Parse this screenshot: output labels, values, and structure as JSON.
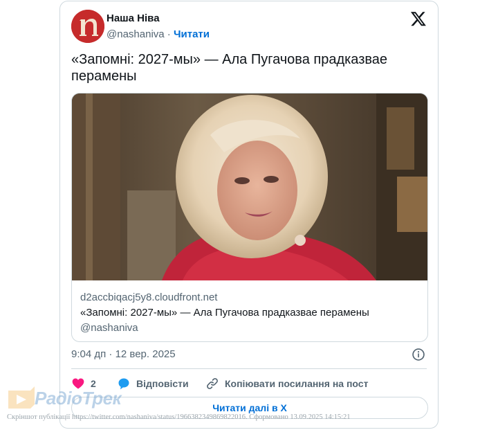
{
  "author": {
    "display_name": "Наша Ніва",
    "handle": "@nashaniva",
    "separator": "·",
    "follow_label": "Читати",
    "avatar_icon": "nasha-niva-logo-icon",
    "avatar_color": "#c62b2b"
  },
  "tweet": {
    "text": "«Запомні: 2027-мы» — Ала Пугачова прадказвае перамены"
  },
  "link_card": {
    "image_alt": "Ала Пугачова",
    "domain": "d2accbiqacj5y8.cloudfront.net",
    "title": "«Запомні: 2027-мы» — Ала Пугачова прадказвае перамены",
    "handle": "@nashaniva"
  },
  "meta": {
    "timestamp": "9:04 дп · 12 вер. 2025"
  },
  "actions": {
    "like_count": "2",
    "reply_label": "Відповісти",
    "copy_label": "Копіювати посилання на пост",
    "like_color": "#f91880",
    "reply_color": "#1d9bf0"
  },
  "read_more_label": "Читати далі в X",
  "watermark": {
    "brand": "РадіоТрек",
    "footer": "Скріншот публікації https://twitter.com/nashaniva/status/1966382349869822016. Сформовано 13.09.2025 14:15:21"
  },
  "colors": {
    "link": "#006fd6",
    "secondary_text": "#536471",
    "border": "#cfd9de"
  }
}
